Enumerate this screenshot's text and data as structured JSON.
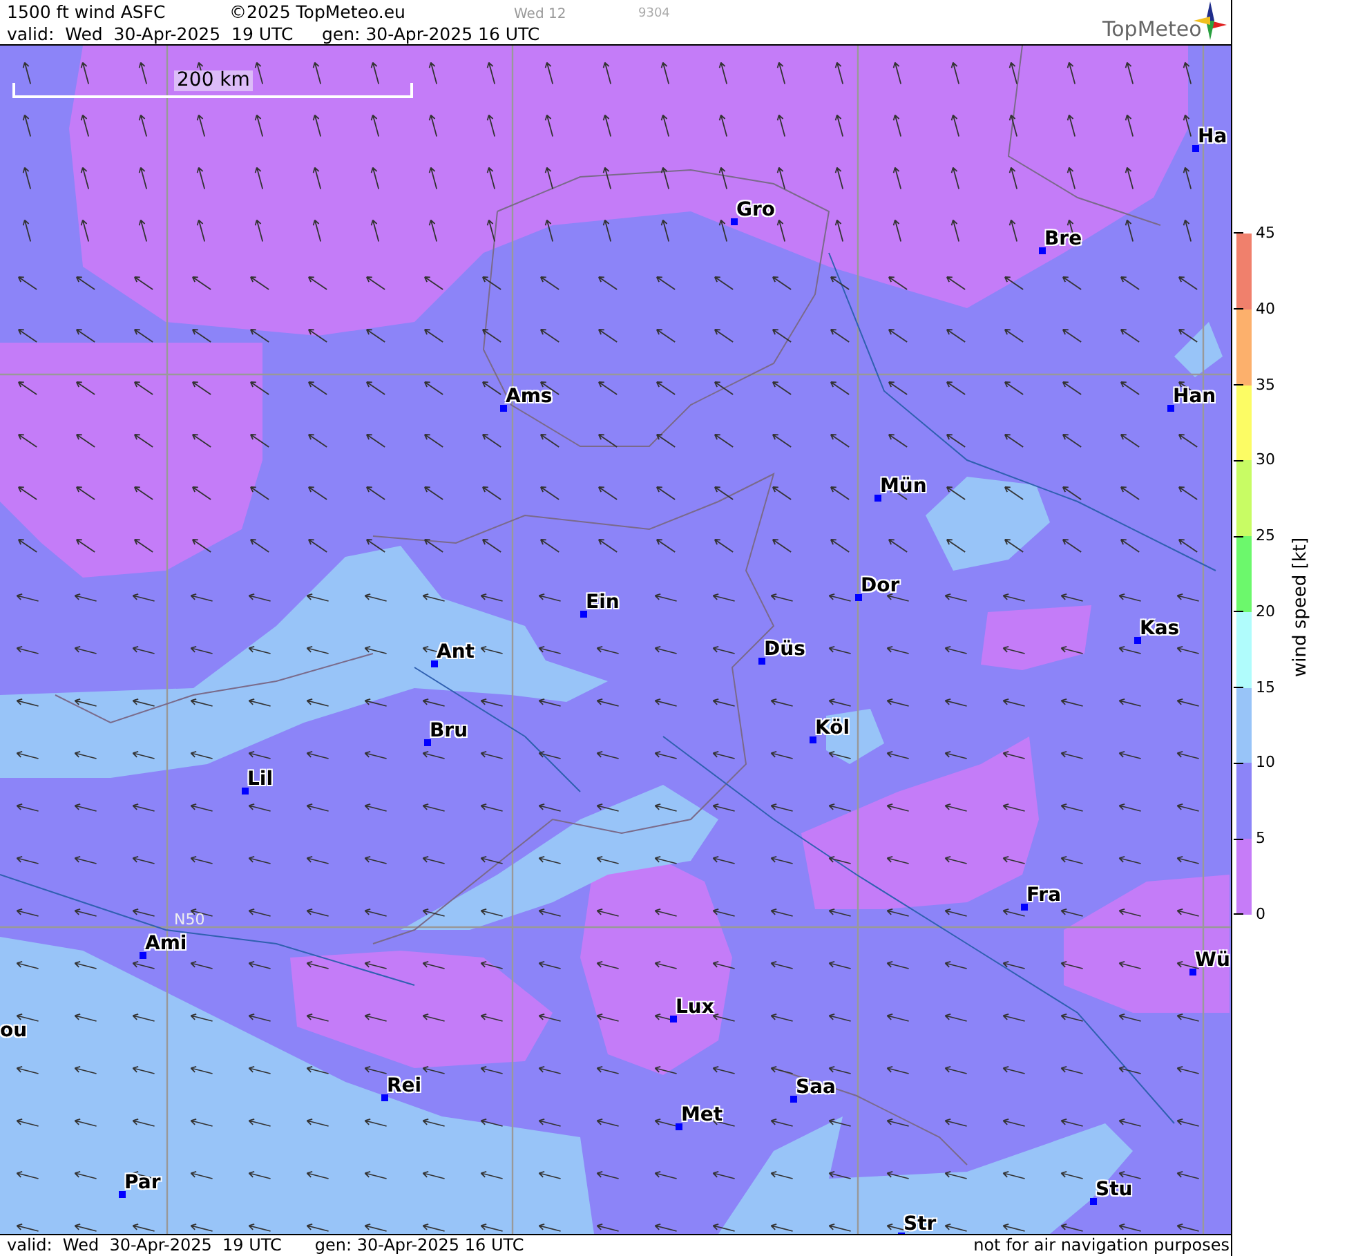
{
  "header": {
    "title": "1500 ft wind ASFC",
    "copyright": "©2025 TopMeteo.eu",
    "day_label": "Wed 12",
    "code": "9304",
    "valid": "valid:  Wed  30-Apr-2025  19 UTC",
    "generated": "gen: 30-Apr-2025 16 UTC",
    "logo": "TopMeteo"
  },
  "map": {
    "scale_label": "200 km",
    "latitude_label": "N50",
    "cities": [
      {
        "name": "Ha"
      },
      {
        "name": "Gro"
      },
      {
        "name": "Bre"
      },
      {
        "name": "Ams"
      },
      {
        "name": "Han"
      },
      {
        "name": "Mün"
      },
      {
        "name": "Dor"
      },
      {
        "name": "Ein"
      },
      {
        "name": "Kas"
      },
      {
        "name": "Düs"
      },
      {
        "name": "Ant"
      },
      {
        "name": "Köl"
      },
      {
        "name": "Bru"
      },
      {
        "name": "Lil"
      },
      {
        "name": "Fra"
      },
      {
        "name": "Ami"
      },
      {
        "name": "Wü"
      },
      {
        "name": "Lux"
      },
      {
        "name": "ou"
      },
      {
        "name": "Rei"
      },
      {
        "name": "Saa"
      },
      {
        "name": "Met"
      },
      {
        "name": "Stu"
      },
      {
        "name": "Par"
      },
      {
        "name": "Str"
      }
    ]
  },
  "legend": {
    "title": "wind speed [kt]",
    "ticks": [
      "45",
      "40",
      "35",
      "30",
      "25",
      "20",
      "15",
      "10",
      "5",
      "0"
    ],
    "bands": [
      {
        "color": "#f0806c"
      },
      {
        "color": "#fcb06c"
      },
      {
        "color": "#fcfc64"
      },
      {
        "color": "#c8fc64"
      },
      {
        "color": "#6cf86c"
      },
      {
        "color": "#b0fcfc"
      },
      {
        "color": "#98c4f8"
      },
      {
        "color": "#8c84f8"
      },
      {
        "color": "#c67cf8"
      }
    ]
  },
  "footer": {
    "valid": "valid:  Wed  30-Apr-2025  19 UTC",
    "generated": "gen: 30-Apr-2025 16 UTC",
    "disclaimer": "not for air navigation purposes"
  }
}
